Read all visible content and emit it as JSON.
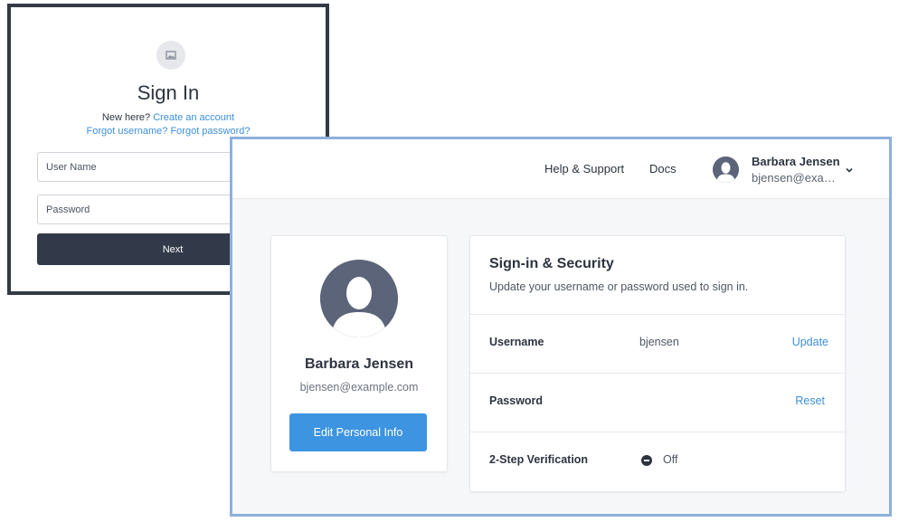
{
  "signin": {
    "logo_icon": "image-icon",
    "title": "Sign In",
    "new_here_text": "New here?",
    "create_account_link": "Create an account",
    "forgot_username_link": "Forgot username?",
    "forgot_password_link": "Forgot password?",
    "username_placeholder": "User Name",
    "password_placeholder": "Password",
    "next_label": "Next"
  },
  "account": {
    "header": {
      "help_link": "Help & Support",
      "docs_link": "Docs",
      "user_name": "Barbara Jensen",
      "user_email": "bjensen@example.com",
      "avatar_icon": "user-silhouette-icon",
      "dropdown_icon": "chevron-down-icon"
    },
    "profile": {
      "name": "Barbara Jensen",
      "email": "bjensen@example.com",
      "edit_button": "Edit Personal Info"
    },
    "security": {
      "title": "Sign-in & Security",
      "subtitle": "Update your username or password used to sign in.",
      "rows": [
        {
          "label": "Username",
          "value": "bjensen",
          "action": "Update"
        },
        {
          "label": "Password",
          "value": "",
          "action": "Reset"
        },
        {
          "label": "2-Step Verification",
          "status": "Off",
          "status_icon": "minus-circle-icon"
        }
      ]
    }
  },
  "colors": {
    "accent": "#3d94e0",
    "link": "#3d8fd9",
    "dark_button": "#323a4a",
    "avatar": "#5b6479",
    "frame": "#8eb0dc"
  }
}
